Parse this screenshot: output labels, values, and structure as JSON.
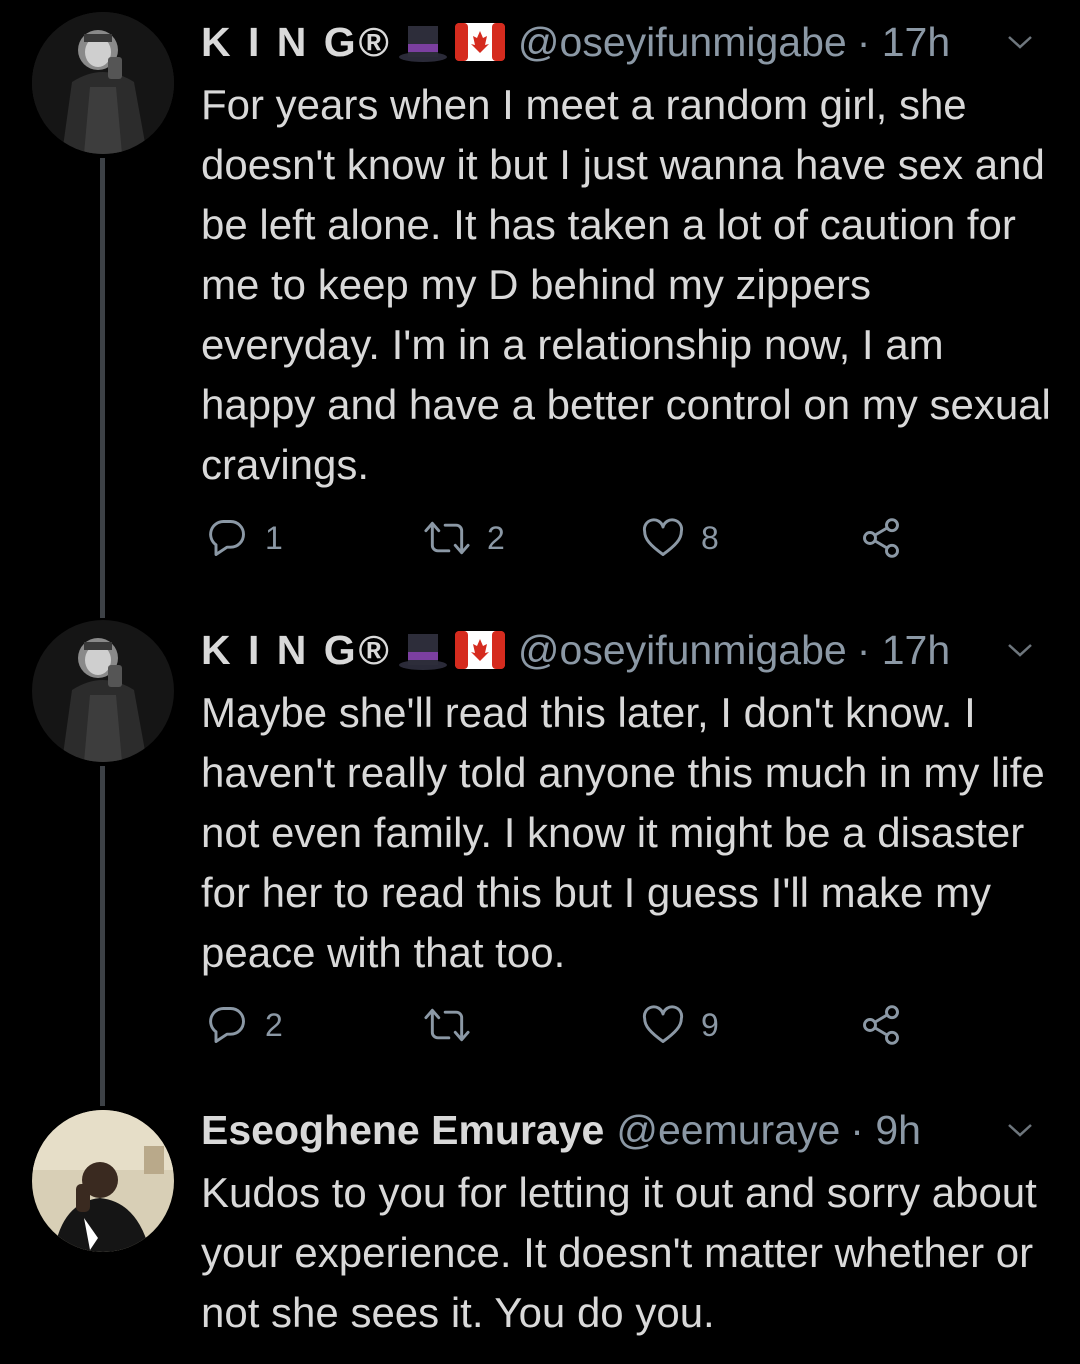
{
  "tweets": [
    {
      "name": "K I N G®",
      "handle": "@oseyifunmigabe",
      "time": "· 17h",
      "text": "For years when I meet a random girl, she doesn't know it but I just wanna have sex and be left alone. It has taken a lot of caution for me to keep my D behind my zippers everyday. I'm in a relationship now, I am happy and have a better control on my sexual cravings.",
      "replies": "1",
      "retweets": "2",
      "likes": "8"
    },
    {
      "name": "K I N G®",
      "handle": "@oseyifunmigabe",
      "time": "· 17h",
      "text": "Maybe she'll read this later, I don't know. I haven't really told anyone this much in my life not even family. I know it might be a disaster for her to read this but I guess I'll make my peace with that too.",
      "replies": "2",
      "retweets": "",
      "likes": "9"
    },
    {
      "name": "Eseoghene Emuraye",
      "handle": "@eemuraye",
      "time": "· 9h",
      "text": "Kudos to you for letting it out and sorry about your experience. It doesn't matter whether or not she sees it. You do you."
    }
  ],
  "colors": {
    "background": "#000000",
    "text": "#d9d9d9",
    "secondary": "#8b98a5",
    "thread_line": "#3d4146"
  },
  "icons": [
    "top-hat-emoji",
    "canada-flag-emoji",
    "chevron-down-icon",
    "reply-icon",
    "retweet-icon",
    "like-icon",
    "share-icon"
  ]
}
